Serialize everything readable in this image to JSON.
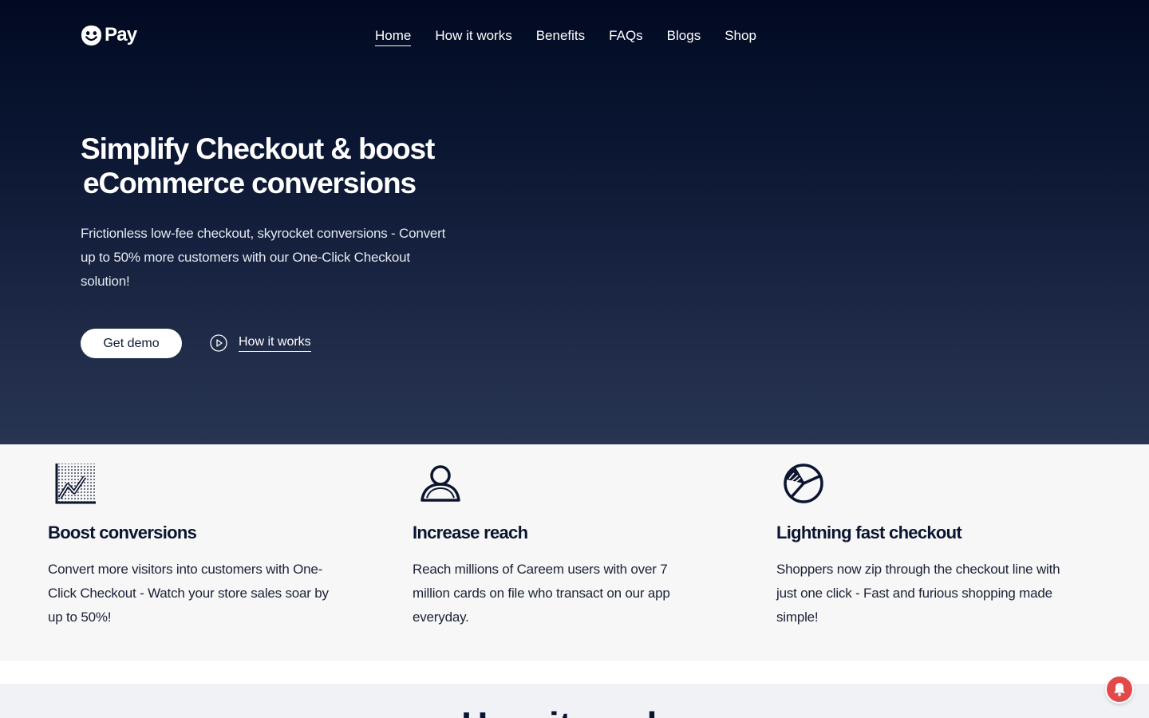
{
  "brand": {
    "name": "Pay",
    "logo_icon": "smiley-face-icon"
  },
  "nav": {
    "items": [
      {
        "label": "Home",
        "active": true
      },
      {
        "label": "How it works"
      },
      {
        "label": "Benefits"
      },
      {
        "label": "FAQs"
      },
      {
        "label": "Blogs"
      },
      {
        "label": "Shop"
      }
    ]
  },
  "hero": {
    "title_line1": "Simplify Checkout & boost",
    "title_line2": "eCommerce conversions",
    "subtitle": "Frictionless low-fee checkout, skyrocket conversions - Convert up to  50%  more customers with our One-Click Checkout solution!",
    "primary_button": "Get demo",
    "secondary_link": "How it works",
    "secondary_icon": "play-circle-icon"
  },
  "features": [
    {
      "icon": "line-chart-icon",
      "title": "Boost conversions",
      "text": "Convert more visitors into customers with One-Click Checkout - Watch your store sales soar by up to 50%!"
    },
    {
      "icon": "user-icon",
      "title": "Increase reach",
      "text": "Reach millions of Careem users with over 7 million cards on file who transact on our app everyday."
    },
    {
      "icon": "pie-chart-icon",
      "title": "Lightning fast checkout",
      "text": "Shoppers now zip through the checkout line with just one click - Fast and furious shopping made simple!"
    }
  ],
  "next_section": {
    "title": "How it works"
  },
  "notification": {
    "icon": "bell-icon"
  },
  "colors": {
    "hero_top": "#020a22",
    "hero_bottom": "#283552",
    "features_bg": "#f7f7f7",
    "notification": "#e24a4a"
  }
}
